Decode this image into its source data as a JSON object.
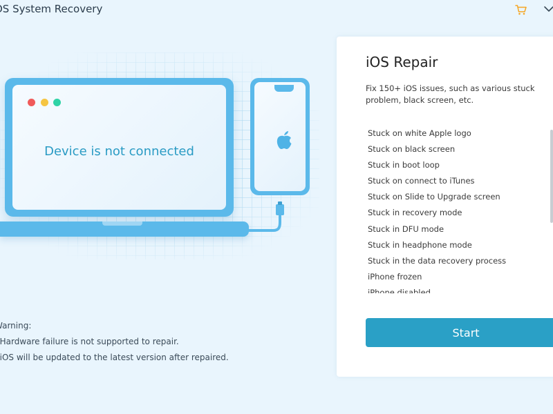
{
  "titlebar": {
    "app_title": "OS System Recovery",
    "icons": [
      "cart-icon",
      "chevron-down-icon"
    ]
  },
  "illustration": {
    "status_text": "Device is not connected",
    "icons": [
      "apple-logo-icon"
    ],
    "colors": {
      "device_frame": "#5bb9ea",
      "status_text": "#2a9bc4",
      "dot_red": "#f05a5a",
      "dot_yellow": "#f5c542",
      "dot_green": "#2fd3a6"
    }
  },
  "warning": {
    "heading": "Warning:",
    "items": [
      ". Hardware failure is not supported to repair.",
      ". iOS will be updated to the latest version after repaired."
    ]
  },
  "panel": {
    "title": "iOS Repair",
    "description": "Fix 150+ iOS issues, such as various stuck problem, black screen, etc.",
    "issues": [
      "Stuck on white Apple logo",
      "Stuck on black screen",
      "Stuck in boot loop",
      "Stuck on connect to iTunes",
      "Stuck on Slide to Upgrade screen",
      "Stuck in recovery mode",
      "Stuck in DFU mode",
      "Stuck in headphone mode",
      "Stuck in the data recovery process",
      "iPhone frozen",
      "iPhone disabled"
    ],
    "start_label": "Start",
    "colors": {
      "start_button": "#2aa0c6"
    }
  }
}
